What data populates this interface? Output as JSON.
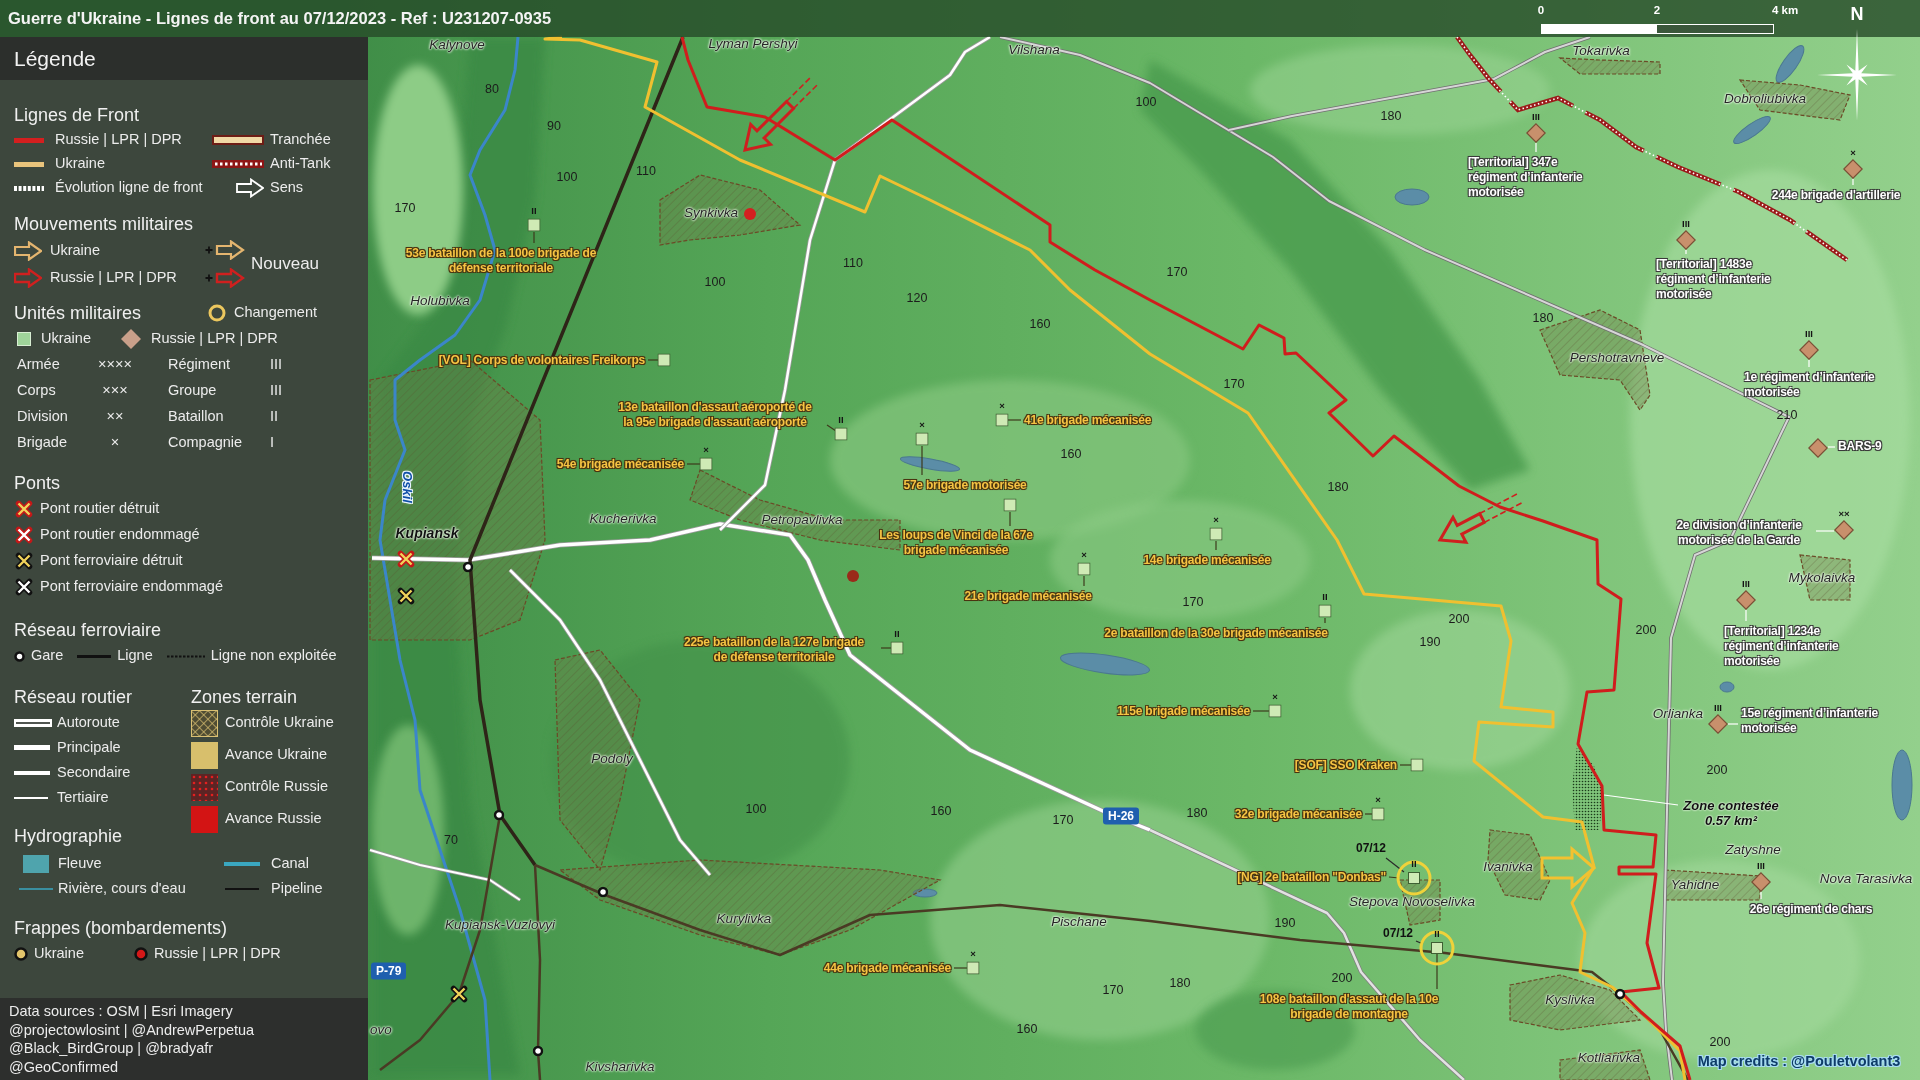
{
  "title": "Guerre d'Ukraine - Lignes de front au 07/12/2023 - Ref : U231207-0935",
  "scale_bar": {
    "ticks": [
      "0",
      "2",
      "4 km"
    ]
  },
  "compass": {
    "label": "N"
  },
  "legend": {
    "title": "Légende",
    "sections": [
      {
        "kind": "front",
        "title": "Lignes de Front",
        "items": [
          {
            "kind": "russianline",
            "label": "Russie | LPR | DPR"
          },
          {
            "kind": "trench",
            "label": "Tranchée"
          },
          {
            "kind": "ukraineline",
            "label": "Ukraine"
          },
          {
            "kind": "antitank",
            "label": "Anti-Tank"
          },
          {
            "kind": "evolution",
            "label": "Évolution ligne de front"
          },
          {
            "kind": "direction",
            "label": "Sens"
          }
        ]
      },
      {
        "kind": "movement",
        "title": "Mouvements militaires",
        "items": [
          {
            "kind": "ukrarrow",
            "label": "Ukraine"
          },
          {
            "kind": "rusarrow",
            "label": "Russie | LPR | DPR"
          }
        ],
        "new_label": "Nouveau"
      },
      {
        "kind": "units",
        "title": "Unités militaires",
        "items": [
          {
            "kind": "changering",
            "label": "Changement"
          },
          {
            "kind": "ukrsquare",
            "label": "Ukraine"
          },
          {
            "kind": "rusdiamond",
            "label": "Russie | LPR | DPR"
          }
        ],
        "echelons": [
          {
            "name": "Armée",
            "symbol": "××××"
          },
          {
            "name": "Régiment",
            "symbol": "III"
          },
          {
            "name": "Corps",
            "symbol": "×××"
          },
          {
            "name": "Groupe",
            "symbol": "III"
          },
          {
            "name": "Division",
            "symbol": "××"
          },
          {
            "name": "Bataillon",
            "symbol": "II"
          },
          {
            "name": "Brigade",
            "symbol": "×"
          },
          {
            "name": "Compagnie",
            "symbol": "I"
          }
        ]
      },
      {
        "kind": "bridges",
        "title": "Ponts",
        "items": [
          {
            "kind": "roaddestroyed",
            "label": "Pont routier détruit"
          },
          {
            "kind": "roaddamaged",
            "label": "Pont routier endommagé"
          },
          {
            "kind": "raildestroyed",
            "label": "Pont ferroviaire détruit"
          },
          {
            "kind": "raildamaged",
            "label": "Pont ferroviaire endommagé"
          }
        ]
      },
      {
        "kind": "rail",
        "title": "Réseau ferroviaire",
        "items": [
          {
            "kind": "station",
            "label": "Gare"
          },
          {
            "kind": "railline",
            "label": "Ligne"
          },
          {
            "kind": "disused",
            "label": "Ligne non exploitée"
          }
        ]
      },
      {
        "kind": "roads",
        "title": "Réseau routier",
        "items": [
          {
            "kind": "highway",
            "label": "Autoroute"
          },
          {
            "kind": "primary",
            "label": "Principale"
          },
          {
            "kind": "secondary",
            "label": "Secondaire"
          },
          {
            "kind": "tertiary",
            "label": "Tertiaire"
          }
        ]
      },
      {
        "kind": "zones",
        "title": "Zones terrain",
        "items": [
          {
            "kind": "ukrcontrol",
            "label": "Contrôle Ukraine"
          },
          {
            "kind": "ukradvance",
            "label": "Avance Ukraine"
          },
          {
            "kind": "ruscontrol",
            "label": "Contrôle Russie"
          },
          {
            "kind": "rusadvance",
            "label": "Avance Russie"
          }
        ]
      },
      {
        "kind": "hydro",
        "title": "Hydrographie",
        "items": [
          {
            "kind": "river",
            "label": "Fleuve"
          },
          {
            "kind": "canal",
            "label": "Canal"
          },
          {
            "kind": "stream",
            "label": "Rivière, cours d'eau"
          },
          {
            "kind": "pipeline",
            "label": "Pipeline"
          }
        ]
      },
      {
        "kind": "strikes",
        "title": "Frappes (bombardements)",
        "items": [
          {
            "kind": "ukrstrike",
            "label": "Ukraine"
          },
          {
            "kind": "russtrike",
            "label": "Russie | LPR | DPR"
          }
        ]
      }
    ]
  },
  "sources": [
    "Data sources : OSM | Esri Imagery",
    "@projectowlosint | @AndrewPerpetua",
    "@Black_BirdGroup | @bradyafr",
    "@GeoConfirmed"
  ],
  "map": {
    "places": [
      {
        "name": "Kalynove",
        "kind": "village"
      },
      {
        "name": "Lyman Pershyi",
        "kind": "village"
      },
      {
        "name": "Vilshana",
        "kind": "village"
      },
      {
        "name": "Tokarivka",
        "kind": "village"
      },
      {
        "name": "Dobroliubivka",
        "kind": "village"
      },
      {
        "name": "Synkivka",
        "kind": "village"
      },
      {
        "name": "Holubivka",
        "kind": "village"
      },
      {
        "name": "Pershotravneve",
        "kind": "village"
      },
      {
        "name": "Kupiansk",
        "kind": "town"
      },
      {
        "name": "Kucherivka",
        "kind": "village"
      },
      {
        "name": "Petropavlivka",
        "kind": "village"
      },
      {
        "name": "Mykolaivka",
        "kind": "village"
      },
      {
        "name": "Orlianka",
        "kind": "village"
      },
      {
        "name": "Podoly",
        "kind": "village"
      },
      {
        "name": "Zatyshne",
        "kind": "village"
      },
      {
        "name": "Ivanivka",
        "kind": "village"
      },
      {
        "name": "Yahidne",
        "kind": "village"
      },
      {
        "name": "Nova Tarasivka",
        "kind": "village"
      },
      {
        "name": "Stepova Novoselivka",
        "kind": "village"
      },
      {
        "name": "Kupiansk-Vuzlovyi",
        "kind": "village"
      },
      {
        "name": "Kurylivka",
        "kind": "village"
      },
      {
        "name": "Pischane",
        "kind": "village"
      },
      {
        "name": "Kyslivka",
        "kind": "village"
      },
      {
        "name": "ovo",
        "kind": "village"
      },
      {
        "name": "Kivsharivka",
        "kind": "village"
      },
      {
        "name": "Kotliarivka",
        "kind": "village"
      }
    ],
    "river_label": "Oskil",
    "elevations": [
      "80",
      "100",
      "90",
      "180",
      "100",
      "110",
      "170",
      "110",
      "100",
      "170",
      "120",
      "160",
      "180",
      "170",
      "210",
      "160",
      "180",
      "170",
      "200",
      "190",
      "200",
      "200",
      "100",
      "160",
      "170",
      "180",
      "70",
      "190",
      "170",
      "180",
      "200",
      "160",
      "200"
    ],
    "road_numbers": [
      "P-79",
      "H-26"
    ],
    "ukrainian_units": [
      {
        "label": "53e bataillon de la 100e brigade de\ndéfense territoriale",
        "echelon": "II",
        "changed": false
      },
      {
        "label": "[VOL] Corps de volontaires Freikorps",
        "changed": false
      },
      {
        "label": "13e bataillon d'assaut aéroporté de\nla 95e brigade d'assaut aéroporté",
        "echelon": "II",
        "changed": false
      },
      {
        "label": "41e brigade mécanisée",
        "echelon": "×",
        "changed": false
      },
      {
        "label": "54e brigade mécanisée",
        "echelon": "×",
        "changed": false
      },
      {
        "label": "57e brigade motorisée",
        "echelon": "×",
        "changed": false
      },
      {
        "label": "Les loups de Vinci de la 67e\nbrigade mécanisée",
        "changed": false
      },
      {
        "label": "14e brigade mécanisée",
        "echelon": "×",
        "changed": false
      },
      {
        "label": "21e brigade mécanisée",
        "echelon": "×",
        "changed": false
      },
      {
        "label": "2e bataillon de la 30e brigade mécanisée",
        "echelon": "II",
        "changed": false
      },
      {
        "label": "225e bataillon de la 127e brigade\nde défense territoriale",
        "echelon": "II",
        "changed": false
      },
      {
        "label": "115e brigade mécanisée",
        "echelon": "×",
        "changed": false
      },
      {
        "label": "[SOF] SSO Kraken",
        "changed": false
      },
      {
        "label": "32e brigade mécanisée",
        "echelon": "×",
        "changed": false
      },
      {
        "label": "[NG] 2e bataillon \"Donbas\"",
        "echelon": "II",
        "changed": true,
        "date": "07/12"
      },
      {
        "label": "44e brigade mécanisée",
        "echelon": "×",
        "changed": false
      },
      {
        "label": "108e bataillon d'assaut de la 10e\nbrigade de montagne",
        "echelon": "II",
        "changed": true,
        "date": "07/12"
      }
    ],
    "russian_units": [
      {
        "label": "[Territorial] 347e\nrégiment d’infanterie\nmotorisée",
        "echelon": "III"
      },
      {
        "label": "244e brigade d'artillerie",
        "echelon": "×"
      },
      {
        "label": "[Territorial] 1483e\nrégiment d’infanterie\nmotorisée",
        "echelon": "III"
      },
      {
        "label": "1e régiment d’infanterie\nmotorisée",
        "echelon": "III"
      },
      {
        "label": "BARS-9"
      },
      {
        "label": "2e division d’infanterie\nmotorisée de la Garde",
        "echelon": "××"
      },
      {
        "label": "[Territorial] 1234e\nrégiment d’infanterie\nmotorisée",
        "echelon": "III"
      },
      {
        "label": "15e régiment d’infanterie\nmotorisée",
        "echelon": "III"
      },
      {
        "label": "26e régiment de chars",
        "echelon": "III"
      }
    ],
    "strikes": [
      {
        "color": "#d42020"
      },
      {
        "color": "#9a2a1a"
      }
    ],
    "bridges": [
      {
        "kind": "roaddestroyed"
      },
      {
        "kind": "raildestroyed"
      },
      {
        "kind": "raildestroyed"
      }
    ],
    "movements": [
      {
        "color": "#cf1f1f"
      },
      {
        "color": "#cf1f1f"
      },
      {
        "color": "#f2c230"
      }
    ],
    "contested_zone": {
      "label": "Zone contestée\n0.57 km²"
    },
    "credits": "Map credits : @Pouletvolant3"
  }
}
